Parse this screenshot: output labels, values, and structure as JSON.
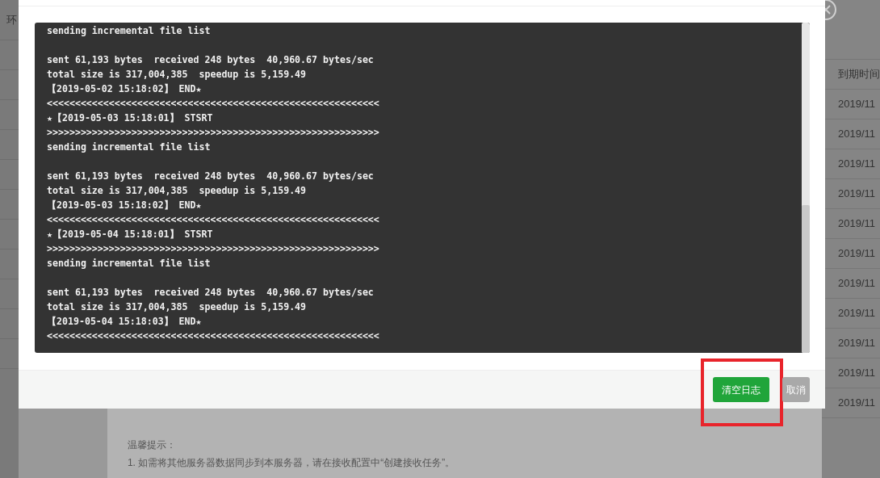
{
  "background_page": {
    "table": {
      "left_header": "环",
      "right_header": "到期时间",
      "rows": [
        "2019/11",
        "2019/11",
        "2019/11",
        "2019/11",
        "2019/11",
        "2019/11",
        "2019/11",
        "2019/11",
        "2019/11",
        "2019/11",
        "2019/11"
      ]
    },
    "tips": {
      "title": "温馨提示：",
      "items": [
        "1. 如需将其他服务器数据同步到本服务器，请在接收配置中“创建接收任务”。"
      ]
    }
  },
  "dialog": {
    "log_lines": [
      {
        "text": "sending incremental file list",
        "blank_before": false
      },
      {
        "text": "sent 61,193 bytes  received 248 bytes  40,960.67 bytes/sec",
        "blank_before": true
      },
      {
        "text": "total size is 317,004,385  speedup is 5,159.49",
        "blank_before": false
      },
      {
        "text": "【2019-05-02 15:18:02】 END★",
        "blank_before": false
      },
      {
        "text": "<<<<<<<<<<<<<<<<<<<<<<<<<<<<<<<<<<<<<<<<<<<<<<<<<<<<<<<<<<<",
        "blank_before": false
      },
      {
        "text": "★【2019-05-03 15:18:01】 STSRT",
        "blank_before": false
      },
      {
        "text": ">>>>>>>>>>>>>>>>>>>>>>>>>>>>>>>>>>>>>>>>>>>>>>>>>>>>>>>>>>>",
        "blank_before": false
      },
      {
        "text": "sending incremental file list",
        "blank_before": false
      },
      {
        "text": "sent 61,193 bytes  received 248 bytes  40,960.67 bytes/sec",
        "blank_before": true
      },
      {
        "text": "total size is 317,004,385  speedup is 5,159.49",
        "blank_before": false
      },
      {
        "text": "【2019-05-03 15:18:02】 END★",
        "blank_before": false
      },
      {
        "text": "<<<<<<<<<<<<<<<<<<<<<<<<<<<<<<<<<<<<<<<<<<<<<<<<<<<<<<<<<<<",
        "blank_before": false
      },
      {
        "text": "★【2019-05-04 15:18:01】 STSRT",
        "blank_before": false
      },
      {
        "text": ">>>>>>>>>>>>>>>>>>>>>>>>>>>>>>>>>>>>>>>>>>>>>>>>>>>>>>>>>>>",
        "blank_before": false
      },
      {
        "text": "sending incremental file list",
        "blank_before": false
      },
      {
        "text": "sent 61,193 bytes  received 248 bytes  40,960.67 bytes/sec",
        "blank_before": true
      },
      {
        "text": "total size is 317,004,385  speedup is 5,159.49",
        "blank_before": false
      },
      {
        "text": "【2019-05-04 15:18:03】 END★",
        "blank_before": false
      },
      {
        "text": "<<<<<<<<<<<<<<<<<<<<<<<<<<<<<<<<<<<<<<<<<<<<<<<<<<<<<<<<<<<",
        "blank_before": false
      }
    ],
    "buttons": [
      {
        "label": "清空日志",
        "kind": "primary",
        "highlighted": true
      },
      {
        "label": "取消",
        "kind": "secondary",
        "highlighted": false
      }
    ]
  }
}
